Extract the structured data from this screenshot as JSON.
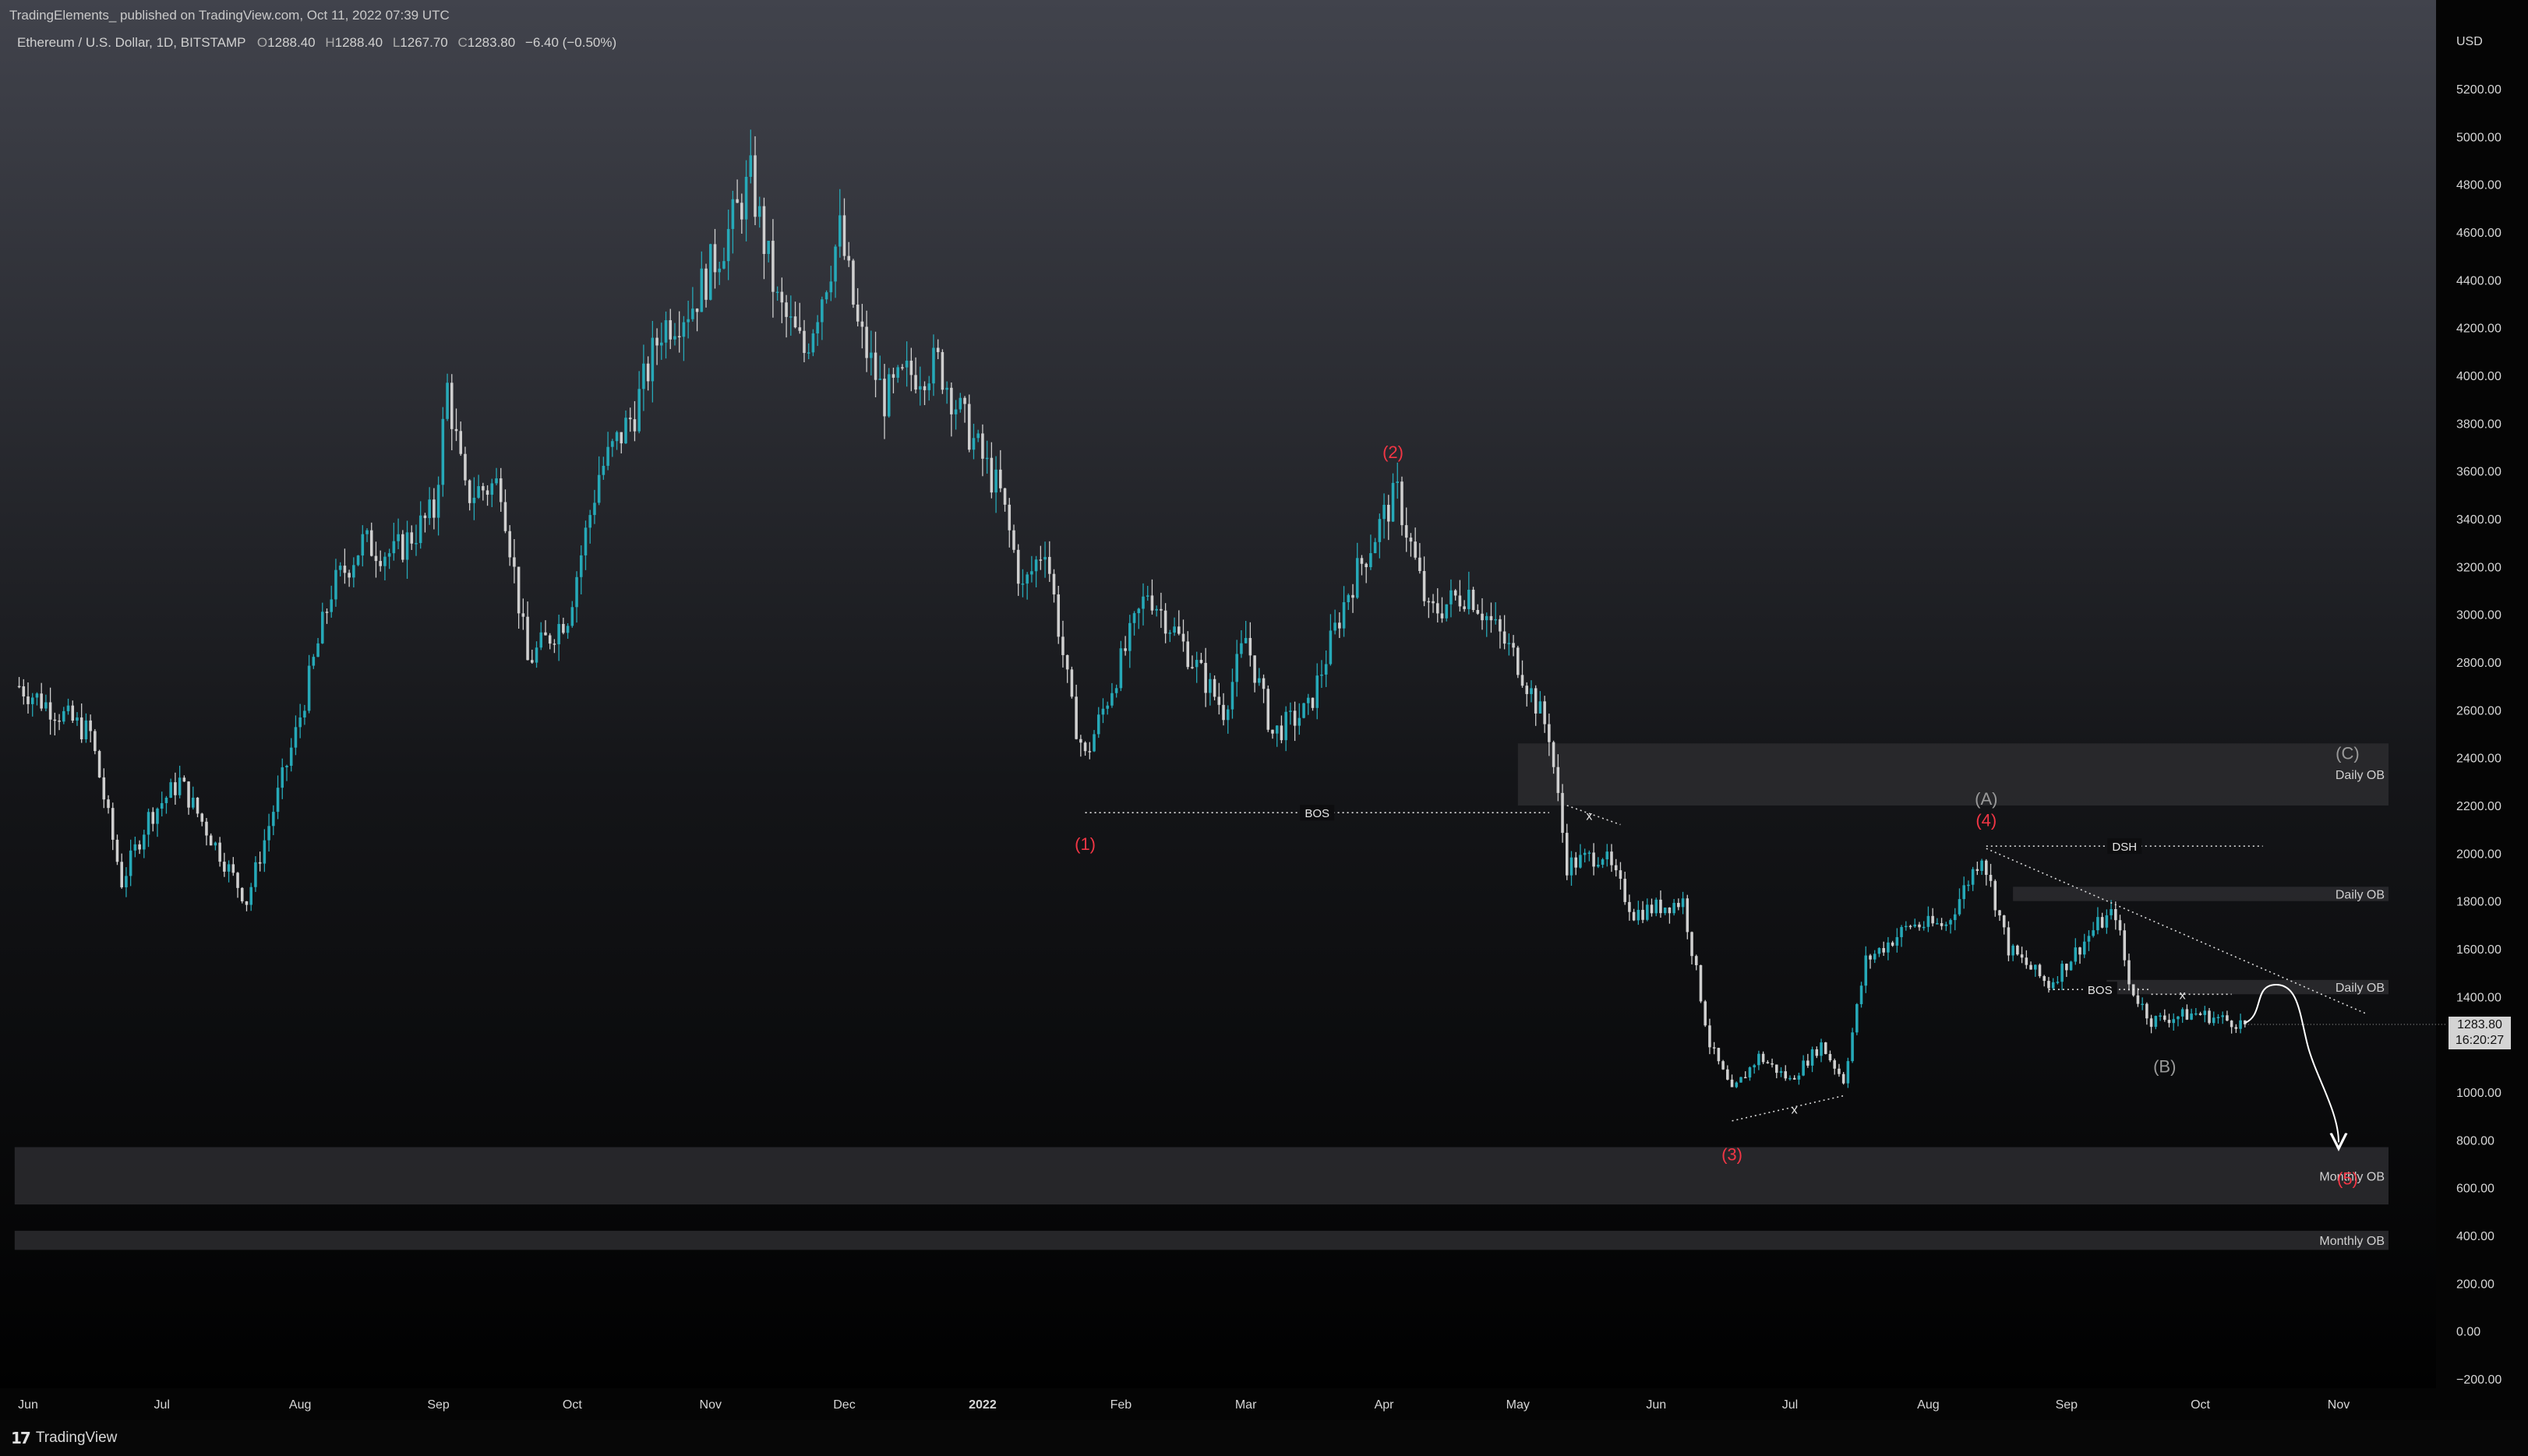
{
  "header": {
    "published": "TradingElements_  published on TradingView.com, Oct 11, 2022 07:39 UTC",
    "symbol_line": "Ethereum / U.S. Dollar, 1D, BITSTAMP",
    "ohlc": {
      "o_label": "O",
      "o": "1288.40",
      "h_label": "H",
      "h": "1288.40",
      "l_label": "L",
      "l": "1267.70",
      "c_label": "C",
      "c": "1283.80",
      "change": "−6.40 (−0.50%)"
    }
  },
  "footer": {
    "brand": "TradingView",
    "logo_icon": "tradingview-logo-icon"
  },
  "price_tag": {
    "price": "1283.80",
    "countdown": "16:20:27"
  },
  "colors": {
    "background_top": "#41434c",
    "background_bottom": "#000000",
    "up": "#26a9b8",
    "down": "#cfcfcf",
    "wave_label": "#f23645",
    "abc_label": "#9a9a9a",
    "ob_zone": "#2a2a2d",
    "text": "#d0d0d0"
  },
  "chart_data": {
    "type": "candlestick",
    "title": "Ethereum / U.S. Dollar, 1D, BITSTAMP",
    "currency_label": "USD",
    "ylim": [
      -200,
      5400
    ],
    "y_ticks": [
      -200,
      0,
      200,
      400,
      600,
      800,
      1000,
      1200,
      1400,
      1600,
      1800,
      2000,
      2200,
      2400,
      2600,
      2800,
      3000,
      3200,
      3400,
      3600,
      3800,
      4000,
      4200,
      4400,
      4600,
      4800,
      5000,
      5200
    ],
    "y_tick_labels": [
      "−200.00",
      "0.00",
      "200.00",
      "400.00",
      "600.00",
      "800.00",
      "1000.00",
      "1200.00",
      "1400.00",
      "1600.00",
      "1800.00",
      "2000.00",
      "2200.00",
      "2400.00",
      "2600.00",
      "2800.00",
      "3000.00",
      "3200.00",
      "3400.00",
      "3600.00",
      "3800.00",
      "4000.00",
      "4200.00",
      "4400.00",
      "4600.00",
      "4800.00",
      "5000.00",
      "5200.00"
    ],
    "x_ticks": [
      {
        "label": "Jun",
        "date": "2021-06-01"
      },
      {
        "label": "Jul",
        "date": "2021-07-01"
      },
      {
        "label": "Aug",
        "date": "2021-08-01"
      },
      {
        "label": "Sep",
        "date": "2021-09-01"
      },
      {
        "label": "Oct",
        "date": "2021-10-01"
      },
      {
        "label": "Nov",
        "date": "2021-11-01"
      },
      {
        "label": "Dec",
        "date": "2021-12-01"
      },
      {
        "label": "2022",
        "date": "2022-01-01"
      },
      {
        "label": "Feb",
        "date": "2022-02-01"
      },
      {
        "label": "Mar",
        "date": "2022-03-01"
      },
      {
        "label": "Apr",
        "date": "2022-04-01"
      },
      {
        "label": "May",
        "date": "2022-05-01"
      },
      {
        "label": "Jun",
        "date": "2022-06-01"
      },
      {
        "label": "Jul",
        "date": "2022-07-01"
      },
      {
        "label": "Aug",
        "date": "2022-08-01"
      },
      {
        "label": "Sep",
        "date": "2022-09-01"
      },
      {
        "label": "Oct",
        "date": "2022-10-01"
      },
      {
        "label": "Nov",
        "date": "2022-11-01"
      }
    ],
    "approx_close_path": [
      {
        "date": "2021-05-30",
        "close": 2700
      },
      {
        "date": "2021-06-07",
        "close": 2600
      },
      {
        "date": "2021-06-15",
        "close": 2500
      },
      {
        "date": "2021-06-22",
        "close": 1880
      },
      {
        "date": "2021-06-28",
        "close": 2150
      },
      {
        "date": "2021-07-05",
        "close": 2300
      },
      {
        "date": "2021-07-14",
        "close": 2000
      },
      {
        "date": "2021-07-20",
        "close": 1800
      },
      {
        "date": "2021-07-31",
        "close": 2500
      },
      {
        "date": "2021-08-08",
        "close": 3100
      },
      {
        "date": "2021-08-15",
        "close": 3300
      },
      {
        "date": "2021-08-22",
        "close": 3250
      },
      {
        "date": "2021-08-31",
        "close": 3430
      },
      {
        "date": "2021-09-03",
        "close": 3950
      },
      {
        "date": "2021-09-07",
        "close": 3500
      },
      {
        "date": "2021-09-15",
        "close": 3550
      },
      {
        "date": "2021-09-21",
        "close": 2800
      },
      {
        "date": "2021-09-30",
        "close": 3000
      },
      {
        "date": "2021-10-07",
        "close": 3590
      },
      {
        "date": "2021-10-15",
        "close": 3850
      },
      {
        "date": "2021-10-21",
        "close": 4200
      },
      {
        "date": "2021-10-28",
        "close": 4300
      },
      {
        "date": "2021-11-05",
        "close": 4600
      },
      {
        "date": "2021-11-10",
        "close": 4820
      },
      {
        "date": "2021-11-16",
        "close": 4300
      },
      {
        "date": "2021-11-22",
        "close": 4100
      },
      {
        "date": "2021-11-30",
        "close": 4600
      },
      {
        "date": "2021-12-04",
        "close": 4200
      },
      {
        "date": "2021-12-10",
        "close": 3900
      },
      {
        "date": "2021-12-15",
        "close": 4000
      },
      {
        "date": "2021-12-22",
        "close": 4050
      },
      {
        "date": "2021-12-28",
        "close": 3800
      },
      {
        "date": "2022-01-05",
        "close": 3500
      },
      {
        "date": "2022-01-10",
        "close": 3100
      },
      {
        "date": "2022-01-15",
        "close": 3300
      },
      {
        "date": "2022-01-21",
        "close": 2600
      },
      {
        "date": "2022-01-24",
        "close": 2400
      },
      {
        "date": "2022-02-07",
        "close": 3100
      },
      {
        "date": "2022-02-14",
        "close": 2900
      },
      {
        "date": "2022-02-24",
        "close": 2600
      },
      {
        "date": "2022-03-01",
        "close": 2900
      },
      {
        "date": "2022-03-07",
        "close": 2500
      },
      {
        "date": "2022-03-15",
        "close": 2600
      },
      {
        "date": "2022-03-24",
        "close": 3100
      },
      {
        "date": "2022-04-02",
        "close": 3450
      },
      {
        "date": "2022-04-04",
        "close": 3500
      },
      {
        "date": "2022-04-11",
        "close": 3000
      },
      {
        "date": "2022-04-20",
        "close": 3100
      },
      {
        "date": "2022-05-01",
        "close": 2800
      },
      {
        "date": "2022-05-08",
        "close": 2500
      },
      {
        "date": "2022-05-12",
        "close": 1950
      },
      {
        "date": "2022-05-20",
        "close": 2000
      },
      {
        "date": "2022-05-27",
        "close": 1750
      },
      {
        "date": "2022-06-07",
        "close": 1800
      },
      {
        "date": "2022-06-13",
        "close": 1200
      },
      {
        "date": "2022-06-18",
        "close": 1000
      },
      {
        "date": "2022-06-24",
        "close": 1150
      },
      {
        "date": "2022-07-01",
        "close": 1050
      },
      {
        "date": "2022-07-08",
        "close": 1200
      },
      {
        "date": "2022-07-13",
        "close": 1050
      },
      {
        "date": "2022-07-18",
        "close": 1550
      },
      {
        "date": "2022-07-28",
        "close": 1700
      },
      {
        "date": "2022-08-05",
        "close": 1700
      },
      {
        "date": "2022-08-13",
        "close": 2000
      },
      {
        "date": "2022-08-19",
        "close": 1600
      },
      {
        "date": "2022-08-28",
        "close": 1450
      },
      {
        "date": "2022-09-08",
        "close": 1700
      },
      {
        "date": "2022-09-12",
        "close": 1750
      },
      {
        "date": "2022-09-15",
        "close": 1450
      },
      {
        "date": "2022-09-20",
        "close": 1300
      },
      {
        "date": "2022-09-30",
        "close": 1330
      },
      {
        "date": "2022-10-11",
        "close": 1284
      }
    ],
    "last_price": 1283.8,
    "zones": [
      {
        "label": "Daily OB",
        "from": 2200,
        "to": 2460,
        "start": "2022-05-01"
      },
      {
        "label": "Daily OB",
        "from": 1800,
        "to": 1860,
        "start": "2022-08-20"
      },
      {
        "label": "Daily OB",
        "from": 1410,
        "to": 1470,
        "start": "2022-09-10"
      },
      {
        "label": "Monthly OB",
        "from": 530,
        "to": 770,
        "start": "2021-05-29"
      },
      {
        "label": "Monthly OB",
        "from": 340,
        "to": 420,
        "start": "2021-05-29"
      }
    ],
    "structure_lines": [
      {
        "label": "BOS",
        "price": 2170,
        "from": "2022-01-24",
        "to": "2022-05-08"
      },
      {
        "label": "DSH",
        "price": 2030,
        "from": "2022-08-14",
        "to": "2022-10-15"
      },
      {
        "label": "BOS",
        "price": 1430,
        "from": "2022-08-28",
        "to": "2022-09-20"
      }
    ],
    "wave_labels": [
      {
        "text": "(1)",
        "date": "2022-01-24",
        "price": 2040,
        "style": "impulse"
      },
      {
        "text": "(2)",
        "date": "2022-04-03",
        "price": 3680,
        "style": "impulse"
      },
      {
        "text": "(3)",
        "date": "2022-06-18",
        "price": 740,
        "style": "impulse"
      },
      {
        "text": "(4)",
        "date": "2022-08-14",
        "price": 2140,
        "style": "impulse"
      },
      {
        "text": "(5)",
        "date": "2022-11-03",
        "price": 640,
        "style": "impulse"
      },
      {
        "text": "(A)",
        "date": "2022-08-14",
        "price": 2230,
        "style": "corrective"
      },
      {
        "text": "(B)",
        "date": "2022-09-23",
        "price": 1110,
        "style": "corrective"
      },
      {
        "text": "(C)",
        "date": "2022-11-03",
        "price": 2420,
        "style": "corrective"
      }
    ],
    "x_marks": [
      {
        "text": "x",
        "date": "2022-05-17",
        "price": 2160
      },
      {
        "text": "x",
        "date": "2022-07-02",
        "price": 930
      },
      {
        "text": "x",
        "date": "2022-09-27",
        "price": 1410
      }
    ],
    "trendline": {
      "from": {
        "date": "2022-08-14",
        "price": 2020
      },
      "to": {
        "date": "2022-11-07",
        "price": 1330
      }
    },
    "projection": [
      {
        "date": "2022-10-11",
        "price": 1290
      },
      {
        "date": "2022-10-18",
        "price": 1450
      },
      {
        "date": "2022-10-25",
        "price": 1200
      },
      {
        "date": "2022-11-01",
        "price": 790
      }
    ]
  }
}
